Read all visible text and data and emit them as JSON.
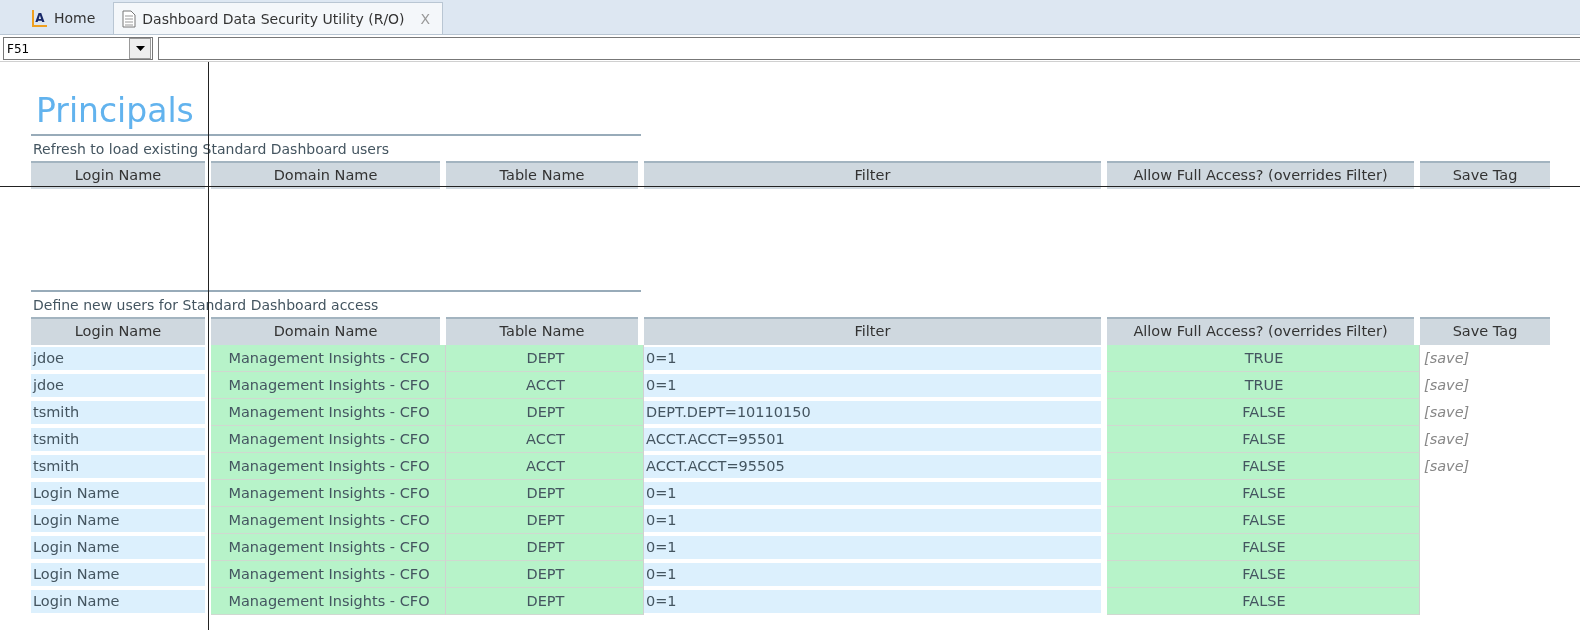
{
  "tabs": [
    {
      "kind": "home",
      "logo": "A",
      "label": "Home",
      "selected": false
    },
    {
      "kind": "document",
      "label": "Dashboard Data Security Utility (R/O)",
      "selected": true,
      "close": "X"
    }
  ],
  "name_box": {
    "value": "F51"
  },
  "sheet": {
    "title": "Principals",
    "existing": {
      "caption": "Refresh to load existing Standard Dashboard users",
      "columns": [
        "Login Name",
        "Domain Name",
        "Table Name",
        "Filter",
        "Allow Full Access? (overrides Filter)",
        "Save Tag"
      ]
    },
    "new_users": {
      "caption": "Define new users for Standard Dashboard access",
      "columns": [
        "Login Name",
        "Domain Name",
        "Table Name",
        "Filter",
        "Allow Full Access? (overrides Filter)",
        "Save Tag"
      ],
      "rows": [
        {
          "login": "jdoe",
          "domain": "Management Insights - CFO",
          "table": "DEPT",
          "filter": "0=1",
          "full_access": "TRUE",
          "save_tag": "[save]"
        },
        {
          "login": "jdoe",
          "domain": "Management Insights - CFO",
          "table": "ACCT",
          "filter": "0=1",
          "full_access": "TRUE",
          "save_tag": "[save]"
        },
        {
          "login": "tsmith",
          "domain": "Management Insights - CFO",
          "table": "DEPT",
          "filter": "DEPT.DEPT=10110150",
          "full_access": "FALSE",
          "save_tag": "[save]"
        },
        {
          "login": "tsmith",
          "domain": "Management Insights - CFO",
          "table": "ACCT",
          "filter": "ACCT.ACCT=95501",
          "full_access": "FALSE",
          "save_tag": "[save]"
        },
        {
          "login": "tsmith",
          "domain": "Management Insights - CFO",
          "table": "ACCT",
          "filter": "ACCT.ACCT=95505",
          "full_access": "FALSE",
          "save_tag": "[save]"
        },
        {
          "login": "Login Name",
          "domain": "Management Insights - CFO",
          "table": "DEPT",
          "filter": "0=1",
          "full_access": "FALSE"
        },
        {
          "login": "Login Name",
          "domain": "Management Insights - CFO",
          "table": "DEPT",
          "filter": "0=1",
          "full_access": "FALSE"
        },
        {
          "login": "Login Name",
          "domain": "Management Insights - CFO",
          "table": "DEPT",
          "filter": "0=1",
          "full_access": "FALSE"
        },
        {
          "login": "Login Name",
          "domain": "Management Insights - CFO",
          "table": "DEPT",
          "filter": "0=1",
          "full_access": "FALSE"
        },
        {
          "login": "Login Name",
          "domain": "Management Insights - CFO",
          "table": "DEPT",
          "filter": "0=1",
          "full_access": "FALSE"
        }
      ]
    }
  }
}
